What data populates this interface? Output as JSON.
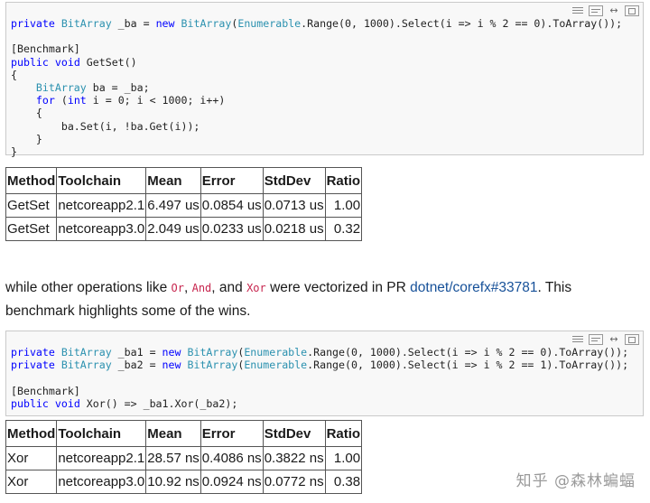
{
  "code_block_1": {
    "lines": [
      "private BitArray _ba = new BitArray(Enumerable.Range(0, 1000).Select(i => i % 2 == 0).ToArray());",
      "",
      "[Benchmark]",
      "public void GetSet()",
      "{",
      "    BitArray ba = _ba;",
      "    for (int i = 0; i < 1000; i++)",
      "    {",
      "        ba.Set(i, !ba.Get(i));",
      "    }",
      "}"
    ]
  },
  "table_1": {
    "headers": [
      "Method",
      "Toolchain",
      "Mean",
      "Error",
      "StdDev",
      "Ratio"
    ],
    "rows": [
      [
        "GetSet",
        "netcoreapp2.1",
        "6.497 us",
        "0.0854 us",
        "0.0713 us",
        "1.00"
      ],
      [
        "GetSet",
        "netcoreapp3.0",
        "2.049 us",
        "0.0233 us",
        "0.0218 us",
        "0.32"
      ]
    ]
  },
  "prose": {
    "part1": "while other operations like ",
    "code1": "Or",
    "part2": ", ",
    "code2": "And",
    "part3": ", and ",
    "code3": "Xor",
    "part4": " were vectorized in PR ",
    "link": "dotnet/corefx#33781",
    "part5": ". This benchmark highlights some of the wins."
  },
  "code_block_2": {
    "lines": [
      "private BitArray _ba1 = new BitArray(Enumerable.Range(0, 1000).Select(i => i % 2 == 0).ToArray());",
      "private BitArray _ba2 = new BitArray(Enumerable.Range(0, 1000).Select(i => i % 2 == 1).ToArray());",
      "",
      "[Benchmark]",
      "public void Xor() => _ba1.Xor(_ba2);"
    ]
  },
  "table_2": {
    "headers": [
      "Method",
      "Toolchain",
      "Mean",
      "Error",
      "StdDev",
      "Ratio"
    ],
    "rows": [
      [
        "Xor",
        "netcoreapp2.1",
        "28.57 ns",
        "0.4086 ns",
        "0.3822 ns",
        "1.00"
      ],
      [
        "Xor",
        "netcoreapp3.0",
        "10.92 ns",
        "0.0924 ns",
        "0.0772 ns",
        "0.38"
      ]
    ]
  },
  "toolbar_icons": [
    "view-source-icon",
    "copy-icon",
    "expand-icon",
    "print-icon"
  ],
  "watermark": "知乎 @森林蝙蝠",
  "colors": {
    "keyword": "#0000ff",
    "type": "#2b91af",
    "inline_code": "#c7254e",
    "link": "#175199"
  }
}
